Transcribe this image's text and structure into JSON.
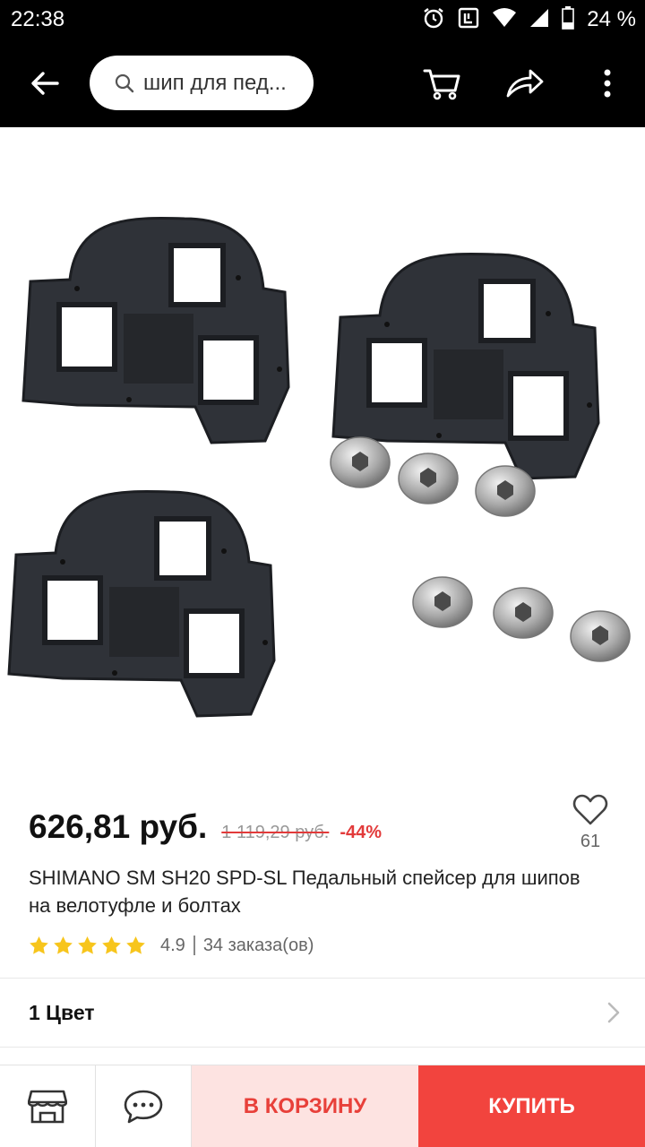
{
  "status_bar": {
    "time": "22:38",
    "battery": "24 %",
    "icons": [
      "alarm-icon",
      "sync-icon",
      "wifi-icon",
      "signal-icon",
      "battery-icon"
    ]
  },
  "app_bar": {
    "search_text": "шип для пед...",
    "icons": [
      "back-arrow-icon",
      "search-icon",
      "cart-icon",
      "share-icon",
      "more-vert-icon"
    ]
  },
  "product": {
    "price": "626,81 руб.",
    "old_price": "1 119,29 руб.",
    "discount": "-44%",
    "wishlist_count": "61",
    "title": "SHIMANO SM SH20 SPD-SL Педальный спейсер для шипов на велотуфле и болтах",
    "rating": "4.9",
    "rating_stars": 5,
    "orders": "34 заказа(ов)"
  },
  "colors": {
    "label": "1 Цвет"
  },
  "bottom_bar": {
    "add_to_cart": "В КОРЗИНУ",
    "buy": "КУПИТЬ",
    "icons": [
      "store-icon",
      "chat-icon"
    ]
  },
  "theme": {
    "accent": "#f2443e",
    "accent_light": "#fde3e1",
    "star": "#f7c51c",
    "discount": "#e23a3a"
  }
}
